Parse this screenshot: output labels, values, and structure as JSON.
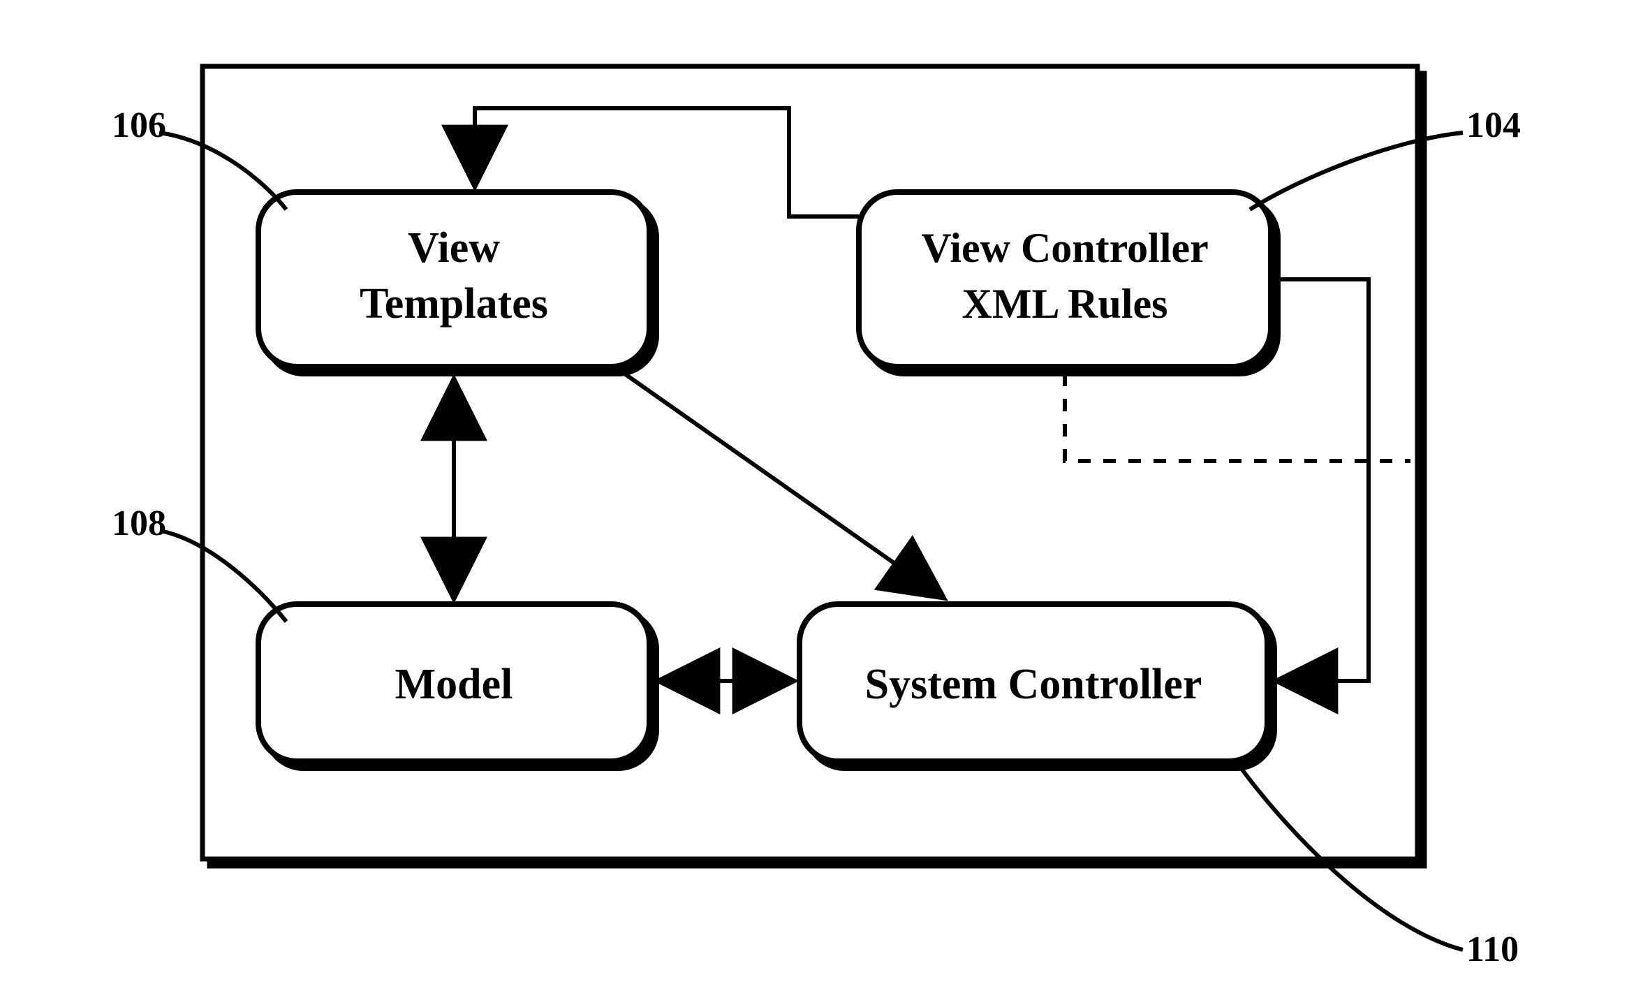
{
  "boxes": {
    "view_templates": {
      "line1": "View",
      "line2": "Templates"
    },
    "view_controller": {
      "line1": "View Controller",
      "line2": "XML Rules"
    },
    "model": {
      "line1": "Model"
    },
    "system_controller": {
      "line1": "System Controller"
    }
  },
  "callouts": {
    "view_templates": "106",
    "view_controller": "104",
    "model": "108",
    "system_controller": "110"
  },
  "chart_data": {
    "type": "diagram",
    "nodes": [
      {
        "id": "view_templates",
        "label": "View Templates",
        "ref": "106"
      },
      {
        "id": "view_controller",
        "label": "View Controller XML Rules",
        "ref": "104"
      },
      {
        "id": "model",
        "label": "Model",
        "ref": "108"
      },
      {
        "id": "system_controller",
        "label": "System Controller",
        "ref": "110"
      }
    ],
    "edges": [
      {
        "from": "view_controller",
        "to": "view_templates",
        "style": "solid",
        "directed": true
      },
      {
        "from": "view_controller",
        "to": "system_controller",
        "style": "solid",
        "directed": true
      },
      {
        "from": "view_controller",
        "to": "system_controller",
        "style": "dashed",
        "directed": false
      },
      {
        "from": "view_templates",
        "to": "model",
        "style": "solid",
        "bidirectional": true
      },
      {
        "from": "view_templates",
        "to": "system_controller",
        "style": "solid",
        "directed": true
      },
      {
        "from": "model",
        "to": "system_controller",
        "style": "solid",
        "bidirectional": true
      }
    ]
  }
}
